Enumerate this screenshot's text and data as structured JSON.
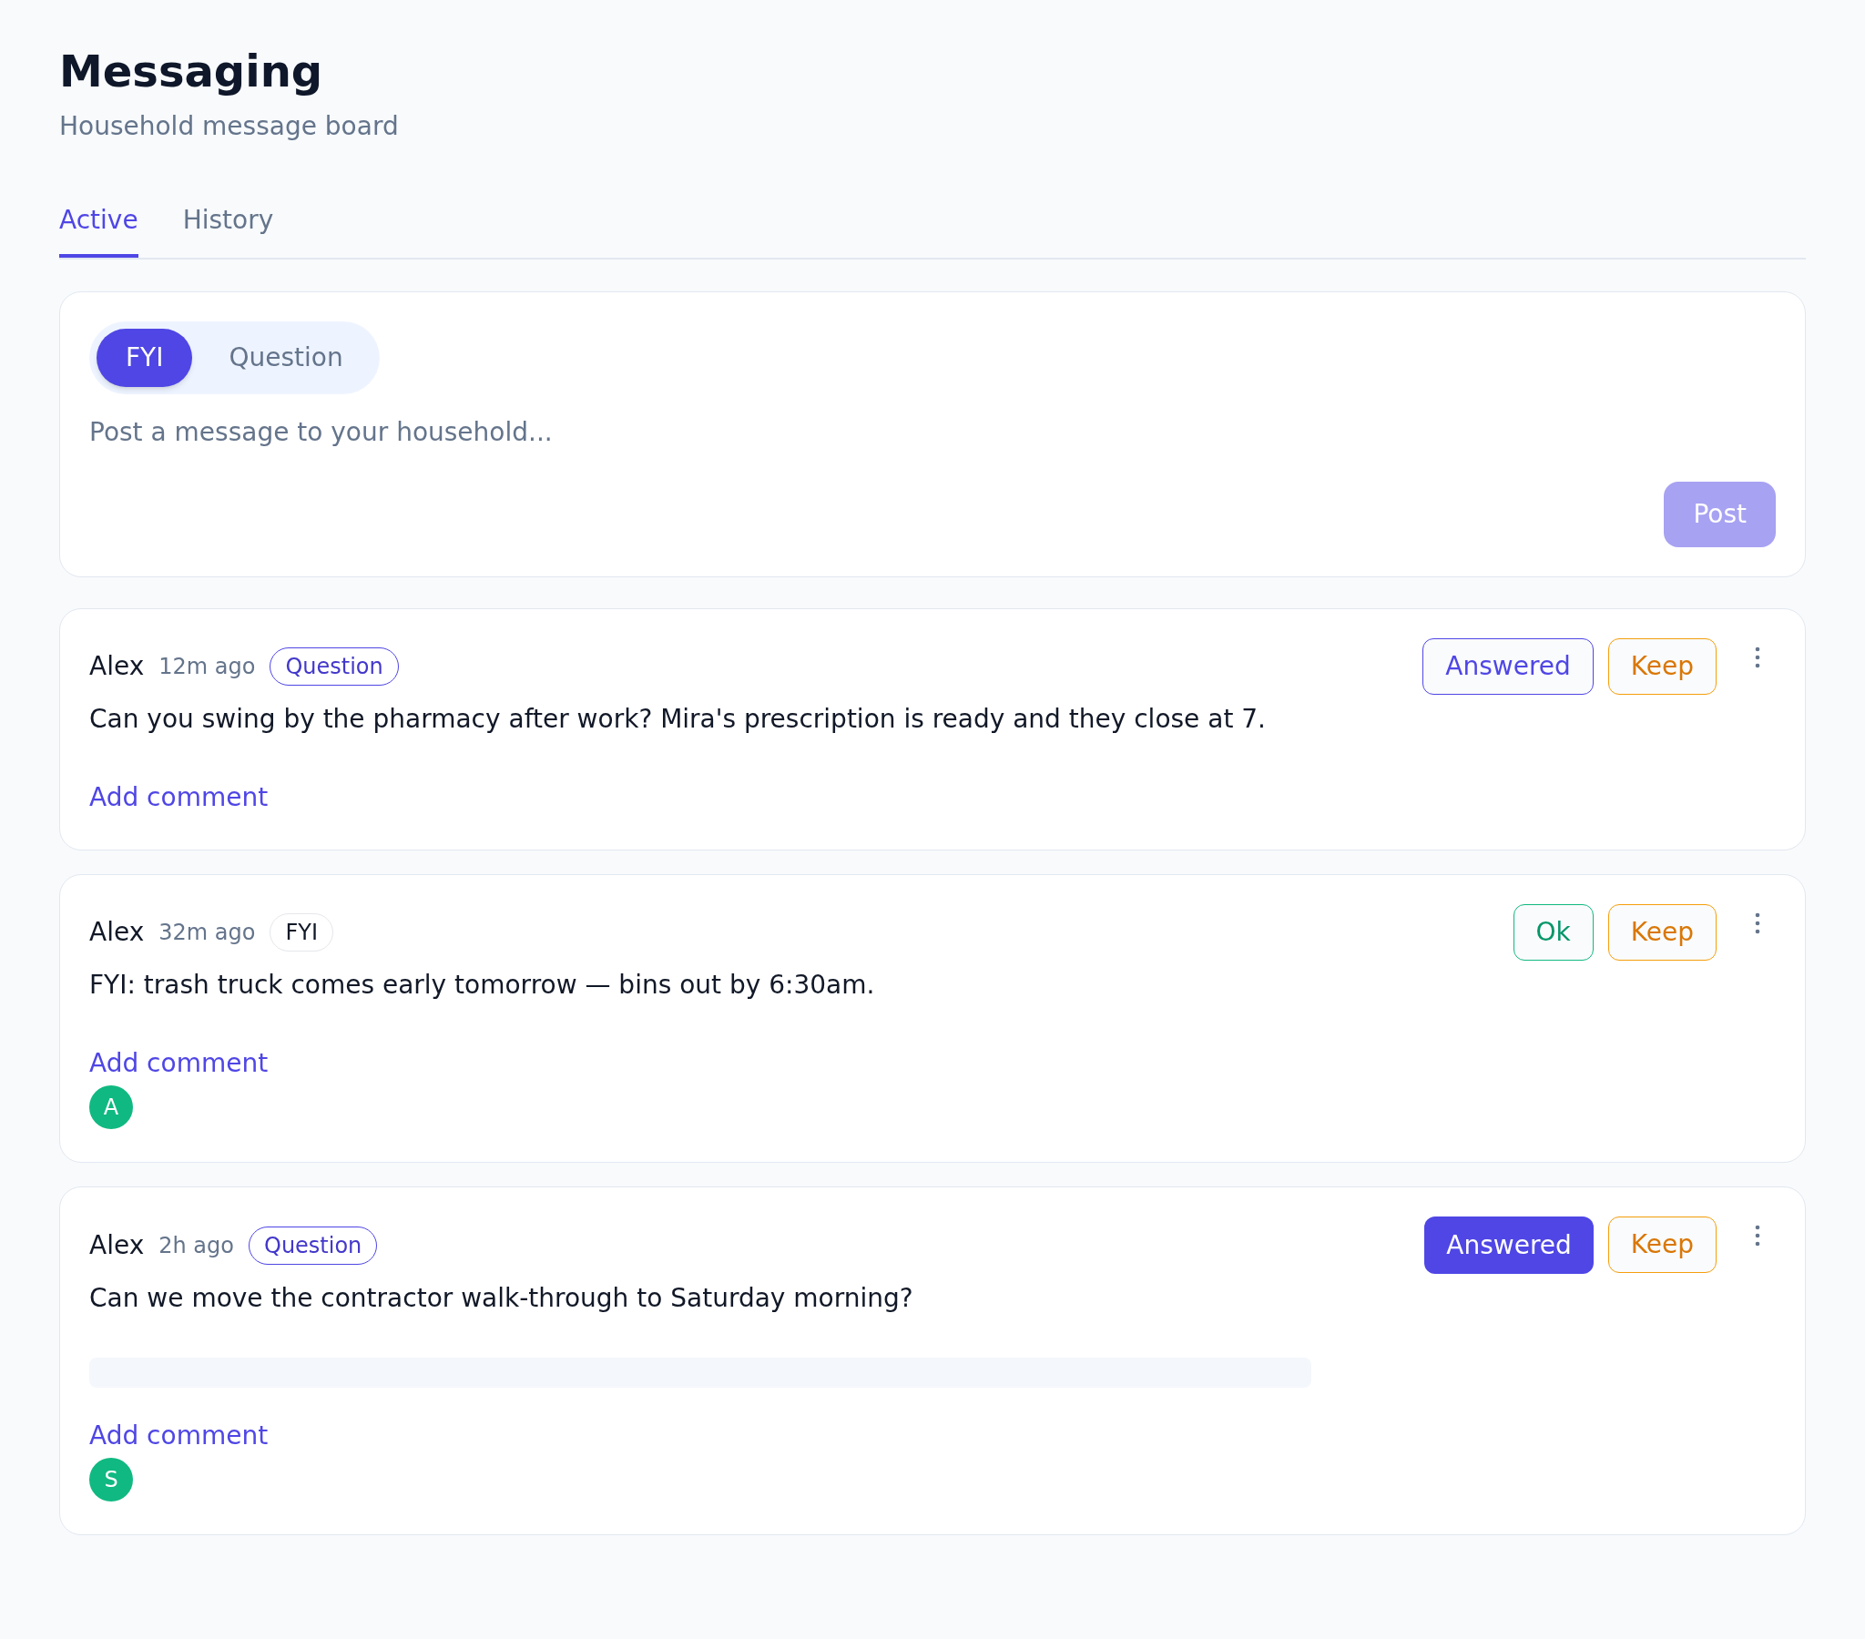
{
  "page": {
    "title": "Messaging",
    "subtitle": "Household message board"
  },
  "tabs": [
    {
      "label": "Active",
      "selected": true
    },
    {
      "label": "History",
      "selected": false
    }
  ],
  "composer": {
    "types": [
      {
        "label": "FYI",
        "selected": true
      },
      {
        "label": "Question",
        "selected": false
      }
    ],
    "placeholder": "Post a message to your household...",
    "post_button": {
      "label": "Post",
      "disabled": true
    }
  },
  "posts": [
    {
      "author": "Alex",
      "time": "12m ago",
      "tag": {
        "label": "Question",
        "kind": "question"
      },
      "actions": [
        {
          "label": "Answered",
          "kind": "answered",
          "on": false
        },
        {
          "label": "Keep",
          "kind": "keep",
          "on": false
        }
      ],
      "text": "Can you swing by the pharmacy after work? Mira's prescription is ready and they close at 7.",
      "comment_link": "Add comment"
    },
    {
      "author": "Alex",
      "time": "32m ago",
      "tag": {
        "label": "FYI",
        "kind": "fyi"
      },
      "actions": [
        {
          "label": "Ok",
          "kind": "ok",
          "on": false
        },
        {
          "label": "Keep",
          "kind": "keep",
          "on": false
        }
      ],
      "text": "FYI: trash truck comes early tomorrow — bins out by 6:30am.",
      "comment_link": "Add comment",
      "avatars": [
        {
          "initial": "A"
        }
      ]
    },
    {
      "author": "Alex",
      "time": "2h ago",
      "tag": {
        "label": "Question",
        "kind": "question"
      },
      "actions": [
        {
          "label": "Answered",
          "kind": "answered",
          "on": true
        },
        {
          "label": "Keep",
          "kind": "keep",
          "on": false
        }
      ],
      "text": "Can we move the contractor walk-through to Saturday morning?",
      "skeleton_line": true,
      "comment_link": "Add comment",
      "avatars": [
        {
          "initial": "S"
        }
      ]
    }
  ]
}
